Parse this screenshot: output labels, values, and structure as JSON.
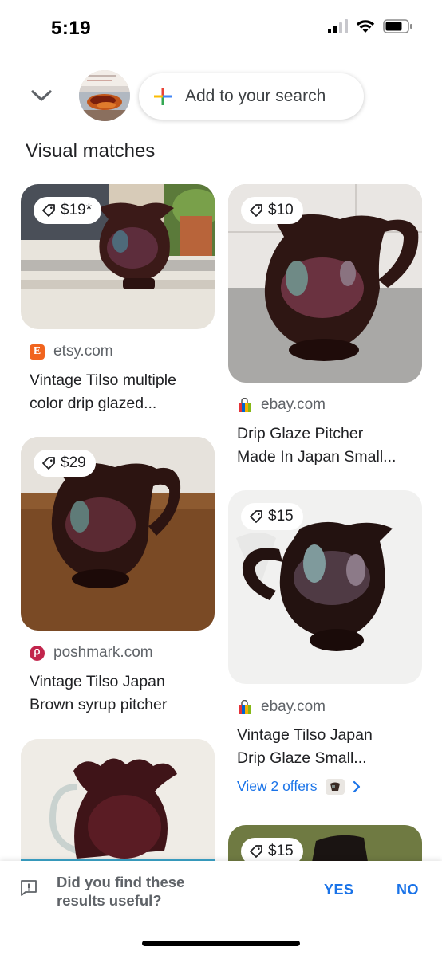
{
  "status_bar": {
    "time": "5:19"
  },
  "header": {
    "add_to_search_label": "Add to your search"
  },
  "section": {
    "title": "Visual matches"
  },
  "results": [
    {
      "price": "$19*",
      "source": "etsy.com",
      "title_line1": "Vintage Tilso multiple",
      "title_line2": "color drip glazed..."
    },
    {
      "price": "$10",
      "source": "ebay.com",
      "title_line1": "Drip Glaze Pitcher",
      "title_line2": "Made In Japan Small..."
    },
    {
      "price": "$29",
      "source": "poshmark.com",
      "title_line1": "Vintage Tilso Japan",
      "title_line2": "Brown syrup pitcher"
    },
    {
      "price": "$15",
      "source": "ebay.com",
      "title_line1": "Vintage Tilso Japan",
      "title_line2": "Drip Glaze Small...",
      "offers_label": "View 2 offers"
    },
    {
      "price": "$15"
    }
  ],
  "feedback": {
    "question_line1": "Did you find these",
    "question_line2": "results useful?",
    "yes_label": "YES",
    "no_label": "NO"
  },
  "colors": {
    "accent": "#1a73e8",
    "etsy": "#f1641e",
    "poshmark": "#c2254c",
    "text_secondary": "#5f6368"
  },
  "icons": [
    "chevron-down-icon",
    "plus-icon",
    "price-tag-icon",
    "feedback-icon",
    "chevron-right-icon",
    "wifi-icon",
    "battery-icon",
    "signal-icon"
  ]
}
